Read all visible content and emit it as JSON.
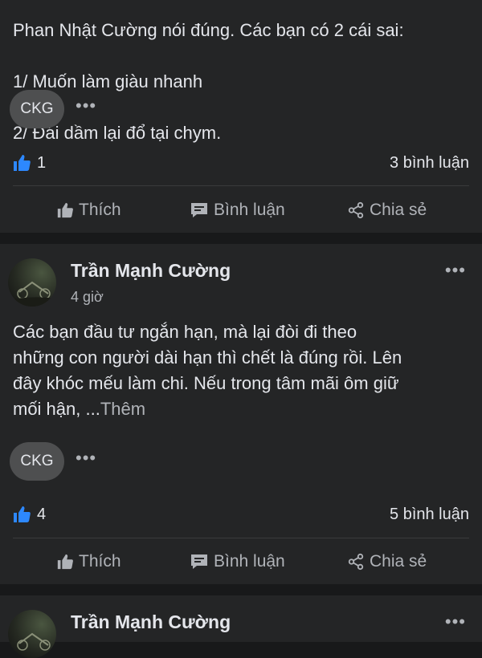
{
  "posts": [
    {
      "text_lines": [
        "Phan Nhật Cường nói đúng. Các bạn có 2 cái sai:",
        "1/ Muốn làm giàu nhanh",
        "2/ Đái dầm lại đổ tại chym."
      ],
      "tag": "CKG",
      "more_dots": "•••",
      "like_count": "1",
      "comment_count": "3 bình luận"
    },
    {
      "author": "Trần Mạnh Cường",
      "time": "4 giờ",
      "menu_dots": "•••",
      "text": "Các bạn đầu tư ngắn hạn, mà lại đòi đi theo\nnhững con người dài hạn thì chết là đúng rồi. Lên\nđây khóc mếu làm chi. Nếu trong tâm mãi ôm giữ\nmối hận, ...",
      "see_more": "Thêm",
      "tag": "CKG",
      "more_dots": "•••",
      "like_count": "4",
      "comment_count": "5 bình luận"
    },
    {
      "author": "Trần Mạnh Cường",
      "menu_dots": "•••"
    }
  ],
  "actions": {
    "like": "Thích",
    "comment": "Bình luận",
    "share": "Chia sẻ"
  },
  "colors": {
    "background": "#18191a",
    "card": "#242526",
    "like_blue": "#2d88ff",
    "muted": "#b0b3b8"
  }
}
